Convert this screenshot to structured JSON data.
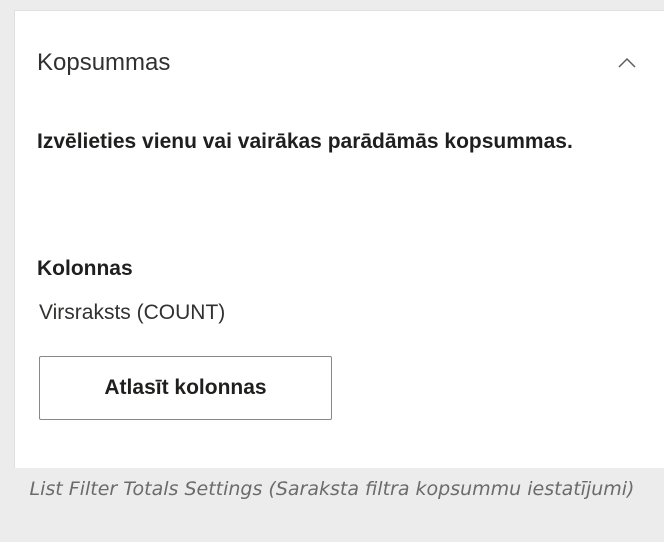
{
  "panel": {
    "title": "Kopsummas",
    "collapse_icon": "chevron-up-icon",
    "instruction": "Izvēlieties vienu vai vairākas parādāmās kopsummas.",
    "columns_label": "Kolonnas",
    "columns_value": "Virsraksts (COUNT)",
    "select_button_label": "Atlasīt kolonnas"
  },
  "caption": "List Filter Totals Settings (Saraksta filtra kopsummu iestatījumi)",
  "colors": {
    "panel_background": "#ffffff",
    "page_background": "#ececec",
    "text": "#201f1e",
    "caption_text": "#6b6b6b",
    "button_border": "#8a8886"
  }
}
